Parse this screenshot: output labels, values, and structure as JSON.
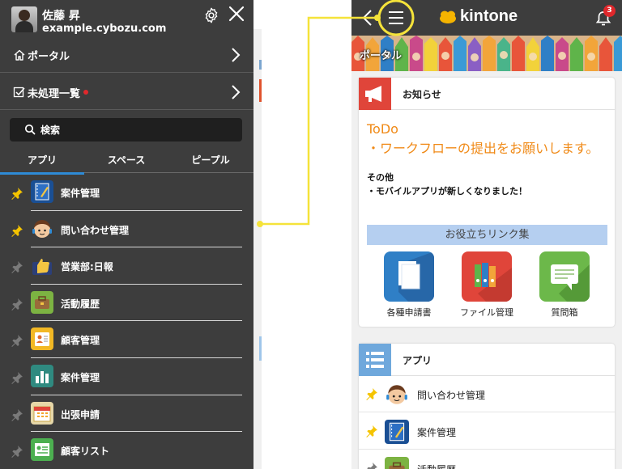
{
  "drawer": {
    "user_name": "佐藤 昇",
    "user_domain": "example.cybozu.com",
    "nav": [
      {
        "label": "ポータル",
        "icon": "home-icon",
        "unread": false
      },
      {
        "label": "未処理一覧",
        "icon": "checkbox-icon",
        "unread": true
      }
    ],
    "search_label": "検索",
    "tabs": [
      {
        "label": "アプリ",
        "active": true
      },
      {
        "label": "スペース",
        "active": false
      },
      {
        "label": "ピープル",
        "active": false
      }
    ],
    "apps": [
      {
        "name": "案件管理",
        "pinned": true,
        "icon": "notebook-icon"
      },
      {
        "name": "問い合わせ管理",
        "pinned": true,
        "icon": "support-person-icon"
      },
      {
        "name": "営業部:日報",
        "pinned": false,
        "icon": "thumbs-up-icon"
      },
      {
        "name": "活動履歴",
        "pinned": false,
        "icon": "briefcase-icon"
      },
      {
        "name": "顧客管理",
        "pinned": false,
        "icon": "contact-card-icon"
      },
      {
        "name": "案件管理",
        "pinned": false,
        "icon": "bar-chart-icon"
      },
      {
        "name": "出張申請",
        "pinned": false,
        "icon": "calendar-icon"
      },
      {
        "name": "顧客リスト",
        "pinned": false,
        "icon": "address-list-icon"
      }
    ]
  },
  "phone": {
    "brand": "kintone",
    "notification_count": "3",
    "portal_title": "ポータル",
    "notice": {
      "title": "お知らせ",
      "todo_lines": [
        "ToDo",
        "・ワークフローの提出をお願いします。"
      ],
      "other_lines": [
        "その他",
        "・モバイルアプリが新しくなりました！"
      ],
      "links_header": "お役立ちリンク集",
      "links": [
        {
          "label": "各種申請書",
          "icon": "document-icon",
          "color": "#2f7fc6"
        },
        {
          "label": "ファイル管理",
          "icon": "binders-icon",
          "color": "#e0453a"
        },
        {
          "label": "質問箱",
          "icon": "speech-bubble-icon",
          "color": "#6cb84a"
        }
      ]
    },
    "apps_card": {
      "title": "アプリ",
      "items": [
        {
          "name": "問い合わせ管理",
          "pinned": true
        },
        {
          "name": "案件管理",
          "pinned": true
        },
        {
          "name": "活動履歴",
          "pinned": true
        }
      ]
    }
  },
  "colors": {
    "drawer_bg": "#3d3d3d",
    "accent_blue": "#2e8bd6",
    "todo_orange": "#f08a17",
    "callout_yellow": "#f5e33a",
    "pin_yellow": "#f5c400"
  }
}
